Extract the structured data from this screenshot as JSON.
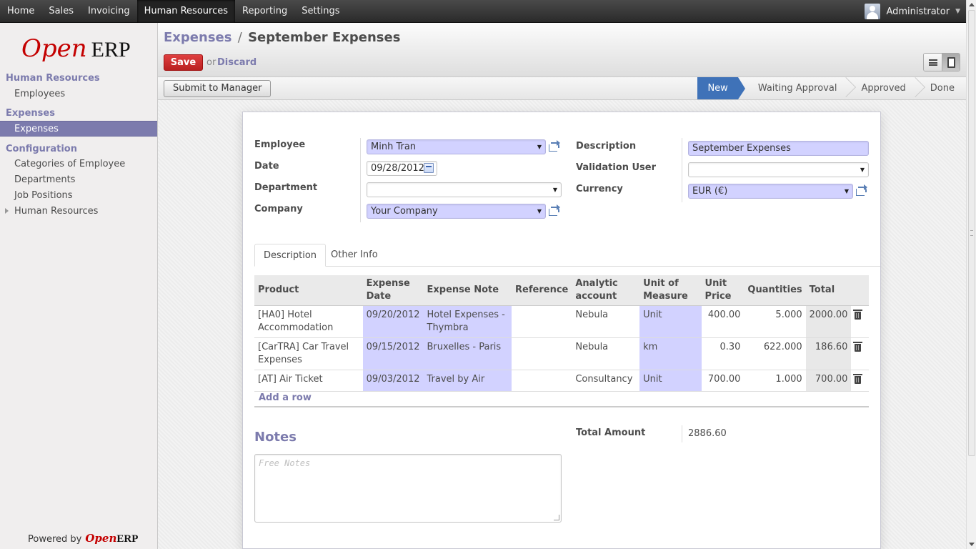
{
  "topbar": {
    "menu": [
      "Home",
      "Sales",
      "Invoicing",
      "Human Resources",
      "Reporting",
      "Settings"
    ],
    "active": "Human Resources",
    "user": "Administrator"
  },
  "sidebar": {
    "logo_open": "Open",
    "logo_erp": "ERP",
    "section_hr": "Human Resources",
    "employees": "Employees",
    "section_expenses": "Expenses",
    "expenses": "Expenses",
    "section_config": "Configuration",
    "categories": "Categories of Employee",
    "departments": "Departments",
    "job_positions": "Job Positions",
    "hr_sub": "Human Resources",
    "powered_by": "Powered by",
    "powered_open": "Open",
    "powered_erp": "ERP"
  },
  "header": {
    "breadcrumb_parent": "Expenses",
    "breadcrumb_sep": "/",
    "breadcrumb_current": "September Expenses",
    "save_label": "Save",
    "or_text": "or",
    "discard_label": "Discard"
  },
  "statusbar": {
    "submit_label": "Submit to Manager",
    "stages": [
      "New",
      "Waiting Approval",
      "Approved",
      "Done"
    ],
    "current_stage": "New"
  },
  "form": {
    "employee_label": "Employee",
    "employee_value": "Minh Tran",
    "date_label": "Date",
    "date_value": "09/28/2012",
    "department_label": "Department",
    "department_value": "",
    "company_label": "Company",
    "company_value": "Your Company",
    "description_label": "Description",
    "description_value": "September Expenses",
    "validation_user_label": "Validation User",
    "validation_user_value": "",
    "currency_label": "Currency",
    "currency_value": "EUR (€)"
  },
  "tabs": [
    "Description",
    "Other Info"
  ],
  "grid": {
    "headers": [
      "Product",
      "Expense Date",
      "Expense Note",
      "Reference",
      "Analytic account",
      "Unit of Measure",
      "Unit Price",
      "Quantities",
      "Total"
    ],
    "rows": [
      {
        "product": "[HA0] Hotel Accommodation",
        "date": "09/20/2012",
        "note": "Hotel Expenses - Thymbra",
        "reference": "",
        "analytic": "Nebula",
        "uom": "Unit",
        "price": "400.00",
        "qty": "5.000",
        "total": "2000.00"
      },
      {
        "product": "[CarTRA] Car Travel Expenses",
        "date": "09/15/2012",
        "note": "Bruxelles - Paris",
        "reference": "",
        "analytic": "Nebula",
        "uom": "km",
        "price": "0.30",
        "qty": "622.000",
        "total": "186.60"
      },
      {
        "product": "[AT] Air Ticket",
        "date": "09/03/2012",
        "note": "Travel by Air",
        "reference": "",
        "analytic": "Consultancy",
        "uom": "Unit",
        "price": "700.00",
        "qty": "1.000",
        "total": "700.00"
      }
    ],
    "add_row": "Add a row"
  },
  "notes": {
    "title": "Notes",
    "placeholder": "Free Notes"
  },
  "totals": {
    "label": "Total Amount",
    "value": "2886.60"
  }
}
